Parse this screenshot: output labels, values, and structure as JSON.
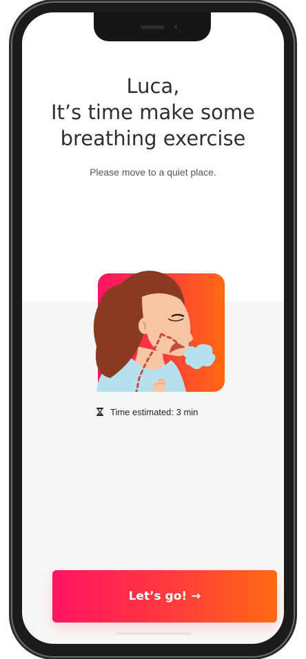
{
  "header": {
    "greeting_name": "Luca,",
    "message_line1": "It’s time make some",
    "message_line2": "breathing exercise",
    "subtitle": "Please move to a quiet place."
  },
  "exercise": {
    "illustration_icon": "woman-breathing-illustration",
    "time_icon": "hourglass-icon",
    "time_estimate": "Time estimated: 3 min"
  },
  "cta": {
    "label": "Let’s go!",
    "arrow": "→"
  },
  "colors": {
    "gradient_start": "#ff1361",
    "gradient_end": "#ff6a12",
    "title_text": "#2e2e33",
    "background": "#f7f7f7"
  }
}
